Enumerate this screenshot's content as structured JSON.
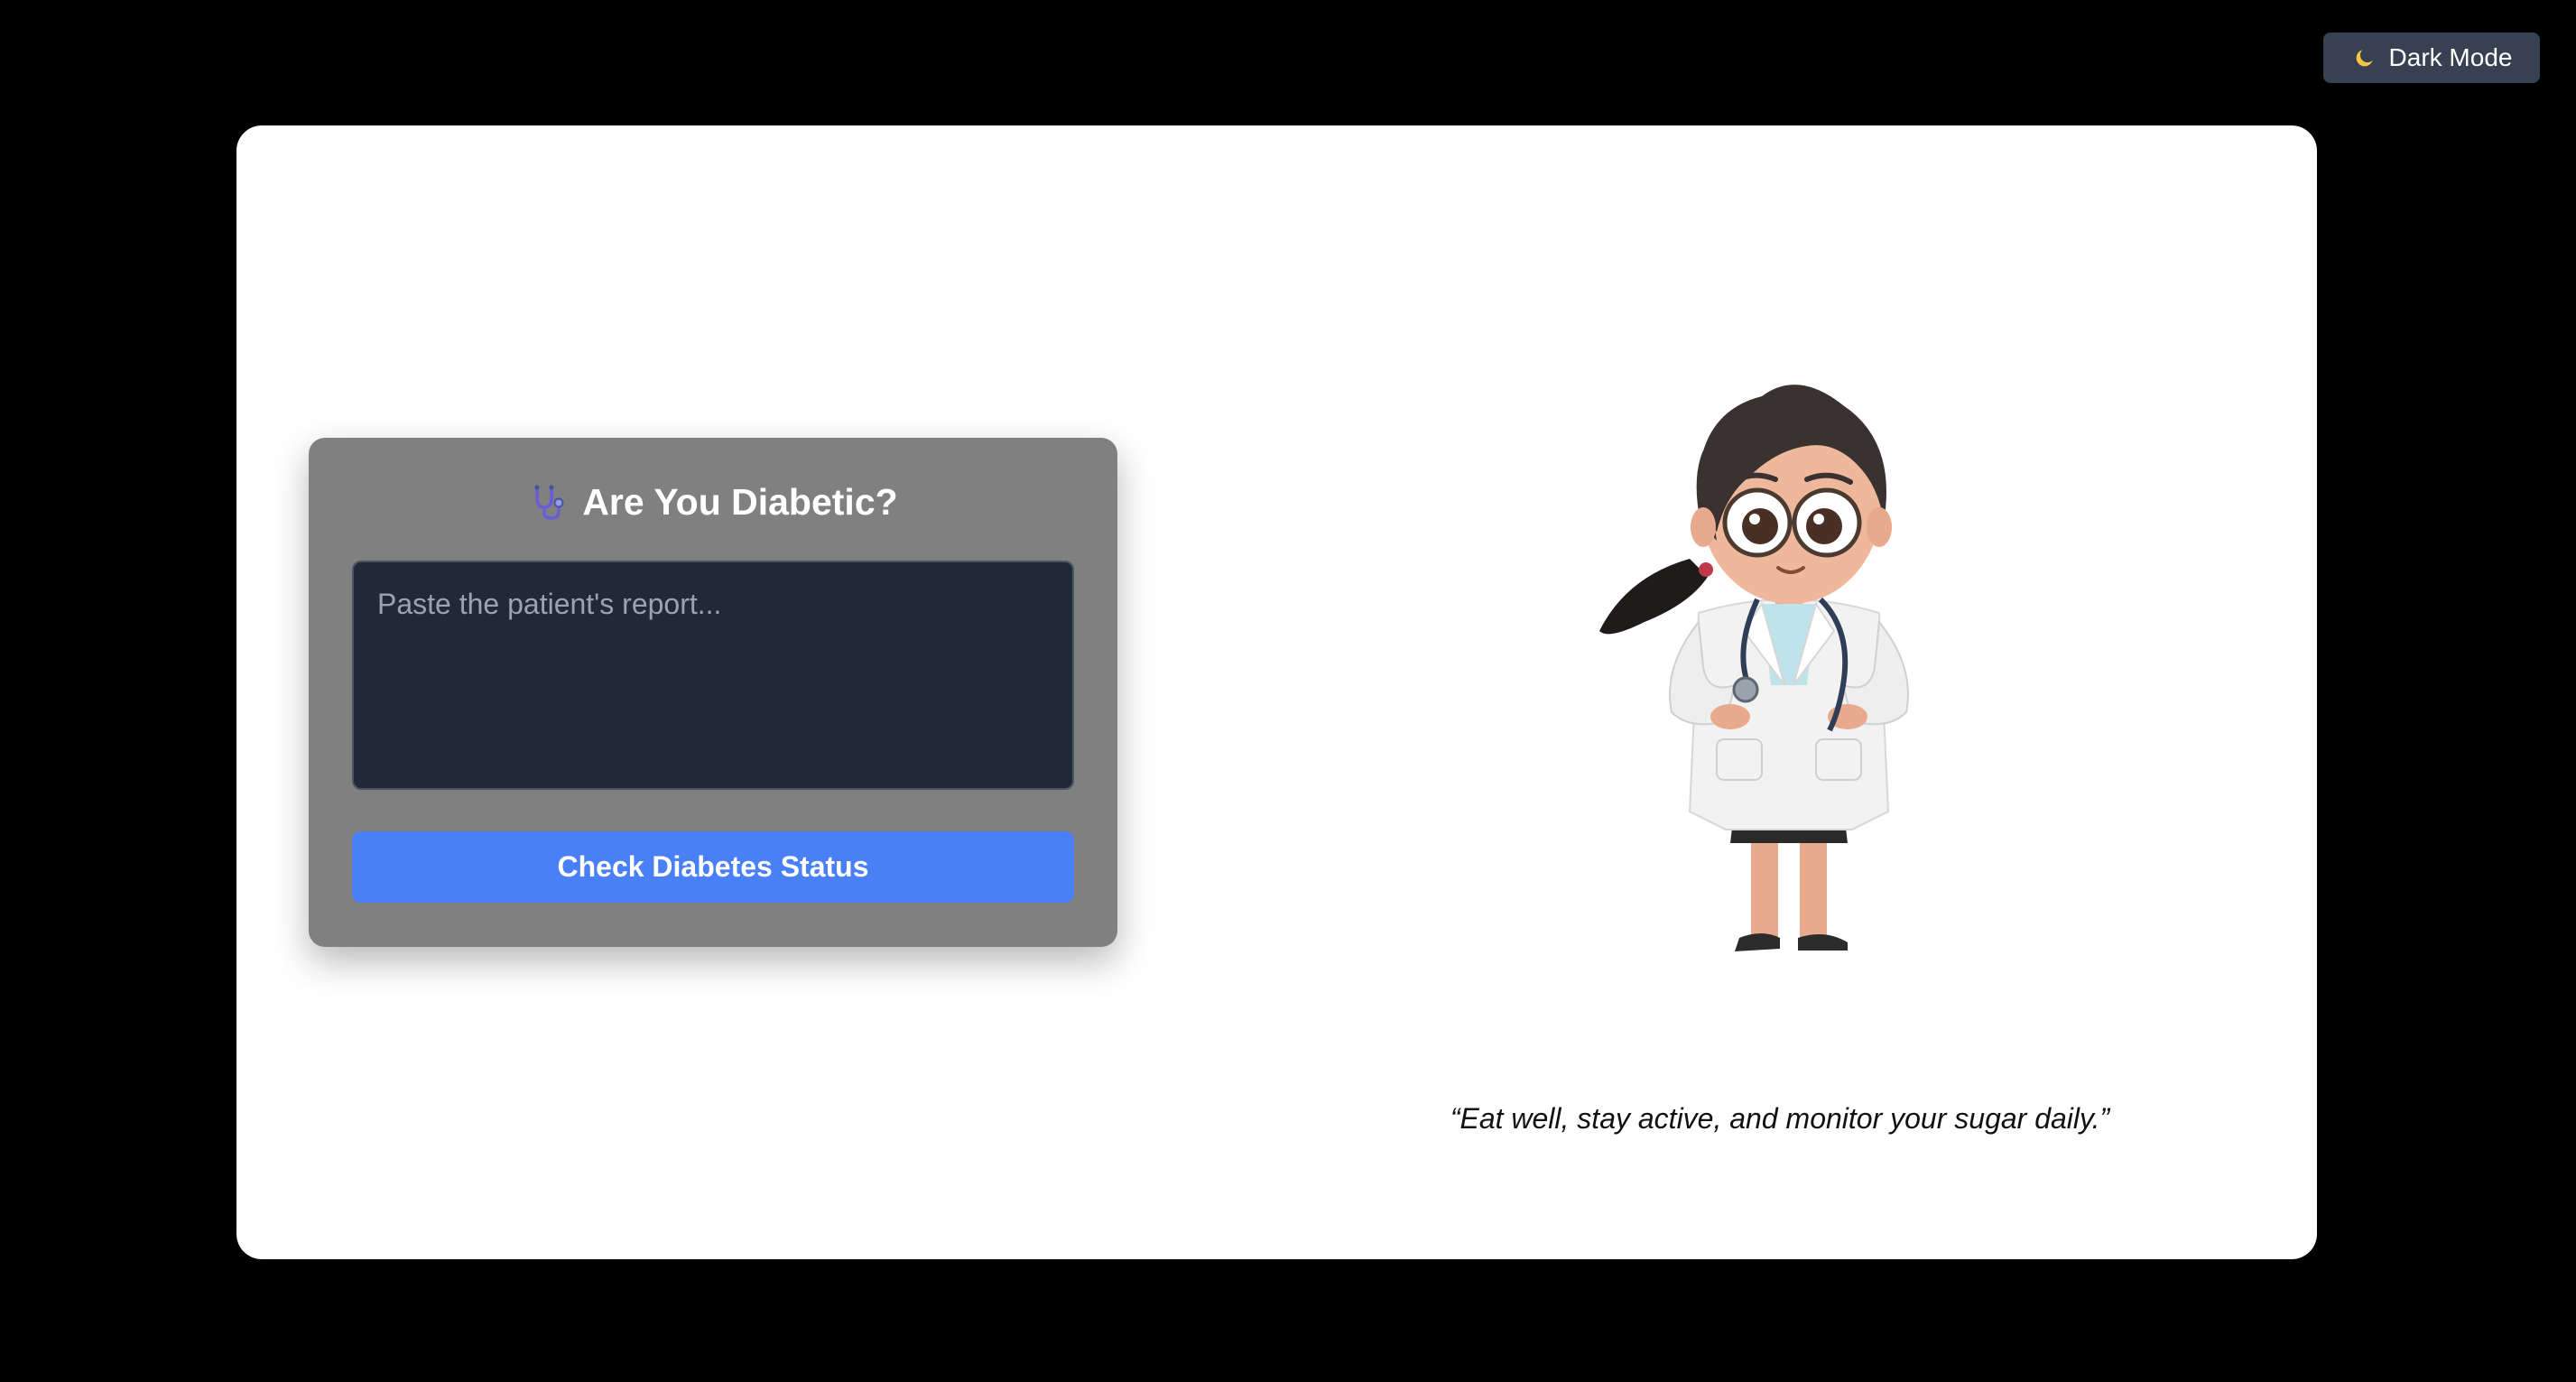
{
  "header": {
    "dark_mode_label": "Dark Mode",
    "dark_mode_icon": "moon-icon"
  },
  "form": {
    "icon": "stethoscope-icon",
    "title": "Are You Diabetic?",
    "report_placeholder": "Paste the patient's report...",
    "report_value": "",
    "submit_label": "Check Diabetes Status"
  },
  "illustration": {
    "name": "doctor-illustration"
  },
  "quote": {
    "text": "“Eat well, stay active, and monitor your sugar daily.”"
  },
  "colors": {
    "page_background": "#000000",
    "card_background": "#ffffff",
    "form_background": "#808080",
    "input_background": "#1f2937",
    "button_primary": "#4a80f7",
    "toggle_background": "#374151"
  }
}
